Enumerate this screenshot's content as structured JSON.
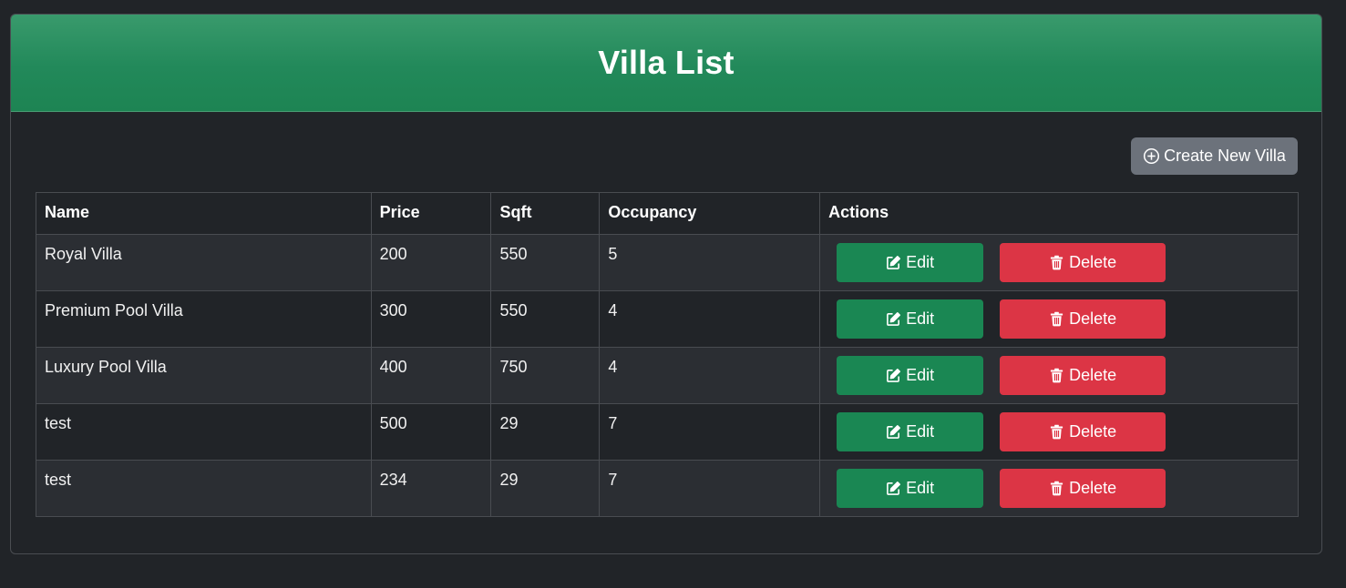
{
  "page_title": "Villa List",
  "create_button_label": "Create New Villa",
  "table": {
    "headers": [
      "Name",
      "Price",
      "Sqft",
      "Occupancy",
      "Actions"
    ],
    "rows": [
      {
        "name": "Royal Villa",
        "price": "200",
        "sqft": "550",
        "occupancy": "5",
        "edit": "Edit",
        "delete": "Delete"
      },
      {
        "name": "Premium Pool Villa",
        "price": "300",
        "sqft": "550",
        "occupancy": "4",
        "edit": "Edit",
        "delete": "Delete"
      },
      {
        "name": "Luxury Pool Villa",
        "price": "400",
        "sqft": "750",
        "occupancy": "4",
        "edit": "Edit",
        "delete": "Delete"
      },
      {
        "name": "test",
        "price": "500",
        "sqft": "29",
        "occupancy": "7",
        "edit": "Edit",
        "delete": "Delete"
      },
      {
        "name": "test",
        "price": "234",
        "sqft": "29",
        "occupancy": "7",
        "edit": "Edit",
        "delete": "Delete"
      }
    ]
  },
  "icons": {
    "create": "plus-circle-icon",
    "edit": "pencil-square-icon",
    "delete": "trash-icon"
  },
  "colors": {
    "header_green": "#1d8453",
    "edit_green": "#1a8753",
    "delete_red": "#dc3545",
    "create_gray": "#6c727b",
    "background": "#212428"
  }
}
